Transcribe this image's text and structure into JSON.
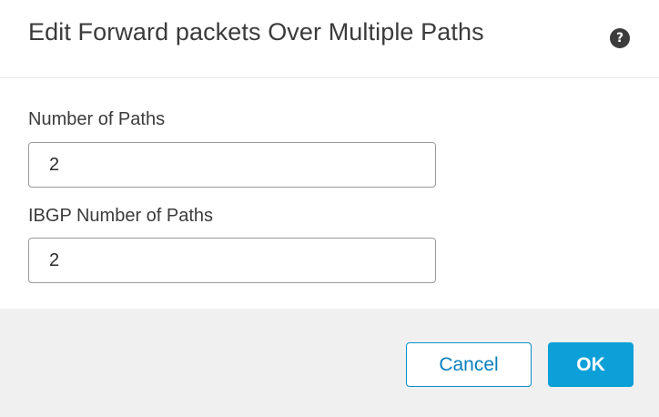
{
  "dialog": {
    "title": "Edit Forward packets Over Multiple Paths",
    "help_icon": "help-icon"
  },
  "fields": {
    "number_of_paths": {
      "label": "Number of Paths",
      "value": "2"
    },
    "ibgp_number_of_paths": {
      "label": "IBGP Number of Paths",
      "value": "2"
    }
  },
  "buttons": {
    "cancel_label": "Cancel",
    "ok_label": "OK"
  },
  "colors": {
    "accent": "#0d9fd8",
    "footer_bg": "#f0f0f0",
    "text": "#3b3b3b"
  }
}
